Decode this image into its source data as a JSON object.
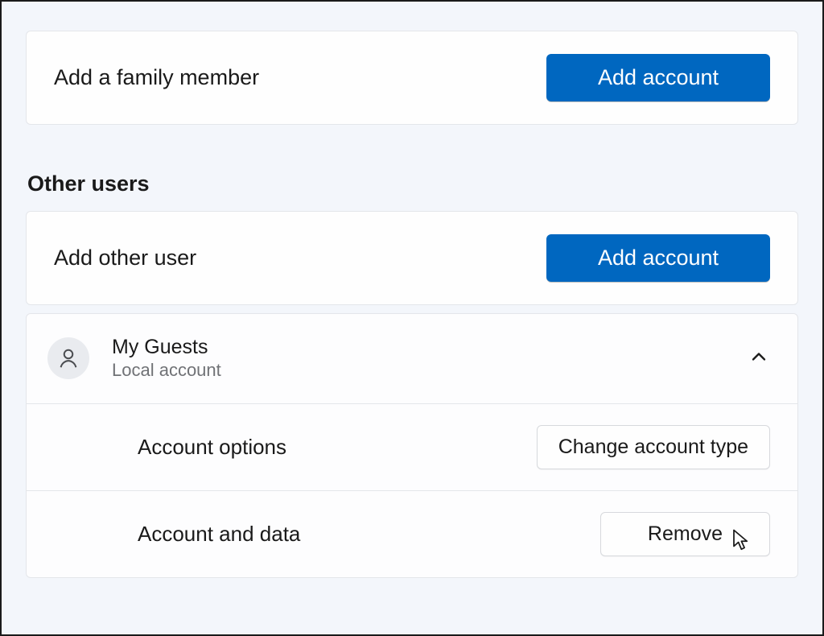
{
  "family": {
    "add_label": "Add a family member",
    "add_button": "Add account"
  },
  "section_heading": "Other users",
  "other": {
    "add_label": "Add other user",
    "add_button": "Add account"
  },
  "user": {
    "name": "My Guests",
    "type": "Local account",
    "options_label": "Account options",
    "change_type_button": "Change account type",
    "data_label": "Account and data",
    "remove_button": "Remove"
  }
}
